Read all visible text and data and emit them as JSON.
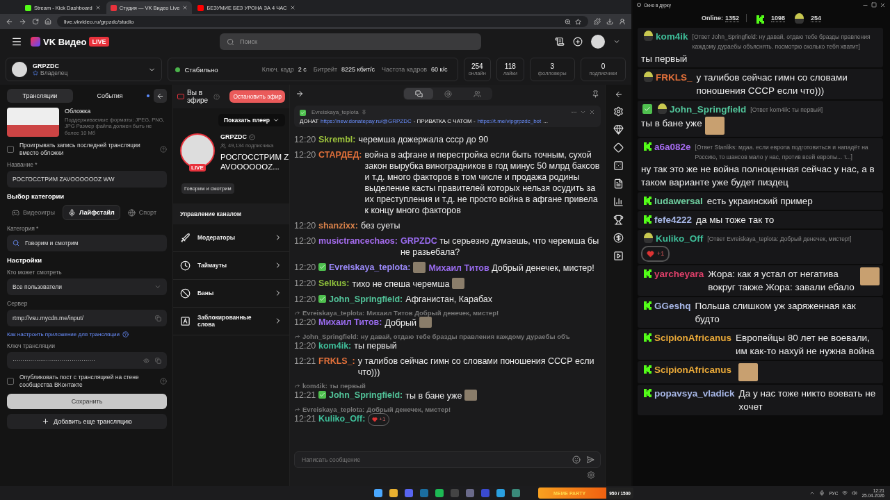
{
  "browser": {
    "tabs": [
      {
        "title": "Stream - Kick Dashboard",
        "selected": false
      },
      {
        "title": "Студия — VK Видео Live",
        "selected": true
      },
      {
        "title": "БЕЗУМИЕ БЕЗ УРОНА ЗА 4 ЧАС",
        "selected": false
      }
    ],
    "url": "live.vkvideo.ru/grpzdc/studio"
  },
  "header": {
    "logo": "VK Видео",
    "logo_badge": "LIVE",
    "search_placeholder": "Поиск"
  },
  "channel_selector": {
    "name": "GRPZDC",
    "role": "Владелец"
  },
  "stream_status": {
    "state": "Стабильно",
    "stats": [
      {
        "label": "Ключ. кадр",
        "value": "2 с"
      },
      {
        "label": "Битрейт",
        "value": "8225 кбит/с"
      },
      {
        "label": "Частота кадров",
        "value": "60 к/с"
      }
    ]
  },
  "counters": [
    {
      "value": "254",
      "label": "онлайн"
    },
    {
      "value": "118",
      "label": "лайки"
    },
    {
      "value": "3",
      "label": "фолловеры"
    },
    {
      "value": "0",
      "label": "подписчики"
    }
  ],
  "settings_panel": {
    "tabs": [
      {
        "label": "Трансляции",
        "selected": true
      },
      {
        "label": "События",
        "selected": false
      }
    ],
    "cover": {
      "title": "Обложка",
      "hint": "Поддерживаемые форматы: JPEG, PNG, JPG Размер файла должен быть не более 10 Мб"
    },
    "replay_checkbox": {
      "label": "Проигрывать запись последней трансляции вместо обложки",
      "checked": false
    },
    "title_field": {
      "label": "Название *",
      "value": "РОСГОССТРИМ ZAVOOOOOOZ WW"
    },
    "category_heading": "Выбор категории",
    "category_types": [
      {
        "label": "Видеоигры",
        "selected": false
      },
      {
        "label": "Лайфстайл",
        "selected": true
      },
      {
        "label": "Спорт",
        "selected": false
      }
    ],
    "category_field": {
      "label": "Категория *",
      "value": "Говорим и смотрим"
    },
    "settings_heading": "Настройки",
    "visibility_field": {
      "label": "Кто может смотреть",
      "value": "Все пользователи"
    },
    "server_field": {
      "label": "Сервер",
      "value": "rtmp://vsu.mycdn.me/input/"
    },
    "help_link": "Как настроить приложение для трансляции",
    "key_field": {
      "label": "Ключ трансляции",
      "value": "··········································"
    },
    "publish_checkbox": {
      "label": "Опубликовать пост с трансляцией на стене сообщества ВКонтакте",
      "checked": false
    },
    "save_button": "Сохранить",
    "add_button": "Добавить еще трансляцию"
  },
  "live_panel": {
    "status": "Вы в эфире",
    "stop_button": "Остановить эфир",
    "player_toggle": "Показать плеер",
    "channel": "GRPZDC",
    "subscribers": "49,134 подписчика",
    "live_badge": "LIVE",
    "stream_title": "РОСГОССТРИМ ZAVOOOOOOZ...",
    "category": "Говорим и смотрим",
    "manage_heading": "Управление каналом",
    "menu": [
      {
        "label": "Модераторы"
      },
      {
        "label": "Таймауты"
      },
      {
        "label": "Баны"
      },
      {
        "label": "Заблокированные слова"
      }
    ]
  },
  "chat": {
    "tabs": [
      {
        "selected": true
      },
      {
        "selected": false
      },
      {
        "selected": false
      }
    ],
    "pinned": {
      "author": "Evreiskaya_teplota",
      "segments": [
        {
          "kind": "text",
          "text": "ДОНАТ"
        },
        {
          "kind": "link",
          "text": "https://new.donatepay.ru/@GRPZDC"
        },
        {
          "kind": "text",
          "text": "- ПРИВАТКА С ЧАТОМ -"
        },
        {
          "kind": "link",
          "text": "https://t.me/vipgrpzdc_bot"
        },
        {
          "kind": "text",
          "text": "..."
        }
      ]
    },
    "messages": [
      {
        "time": "12:20",
        "badge": false,
        "name": "Skrembl:",
        "color": "#9cc23c",
        "parts": [
          {
            "kind": "text",
            "text": "черемша дожержала ссср до 90"
          }
        ]
      },
      {
        "time": "12:20",
        "badge": false,
        "name": "СТАРДЕД:",
        "color": "#e2703a",
        "parts": [
          {
            "kind": "text",
            "text": "война в афгане и перестройка если быть точным, сухой закон вырубка виноградников в год минус 50 млрд баксов и т.д. много факторов в том числе и продажа родины выделение касты правителей которых нельзя осудить за их преступления и т.д. не просто война в афгане привела к концу много факторов"
          }
        ]
      },
      {
        "time": "12:20",
        "badge": false,
        "name": "shanzixx:",
        "color": "#d9824a",
        "parts": [
          {
            "kind": "text",
            "text": "без суеты"
          }
        ]
      },
      {
        "time": "12:20",
        "badge": false,
        "name": "musictrancechaos:",
        "color": "#a66cf0",
        "parts": [
          {
            "kind": "text",
            "text": "**GRPZDC** ты серьезно думаешь, что черемша бы не разьебала?"
          }
        ]
      },
      {
        "time": "12:20",
        "badge": true,
        "name": "Evreiskaya_teplota:",
        "color": "#9e8cff",
        "parts": [
          {
            "kind": "emote"
          },
          {
            "kind": "text",
            "text": "**Михаил Титов** Добрый денечек, мистер!"
          }
        ]
      },
      {
        "time": "12:20",
        "badge": false,
        "name": "Selkus:",
        "color": "#8fc03c",
        "parts": [
          {
            "kind": "text",
            "text": "тихо не спеша черемша"
          },
          {
            "kind": "emote"
          }
        ]
      },
      {
        "time": "12:20",
        "badge": true,
        "name": "John_Springfield:",
        "color": "#52c49a",
        "parts": [
          {
            "kind": "text",
            "text": "Афганистан, Карабах"
          }
        ]
      },
      {
        "time": "12:20",
        "badge": false,
        "name": "Михаил Титов:",
        "color": "#9a6cf0",
        "reply": {
          "name": "Evreiskaya_teplota:",
          "text": "Михаил Титов Добрый денечек, мистер!"
        },
        "parts": [
          {
            "kind": "text",
            "text": "Добрый"
          },
          {
            "kind": "emote"
          }
        ]
      },
      {
        "time": "12:20",
        "badge": false,
        "name": "kom4ik:",
        "color": "#3fbf9a",
        "reply": {
          "name": "John_Springfield:",
          "text": "ну давай, отдаю тебе бразды правления каждому дураебы объ"
        },
        "parts": [
          {
            "kind": "text",
            "text": "ты первый"
          }
        ]
      },
      {
        "time": "12:21",
        "badge": false,
        "name": "FRKLS_:",
        "color": "#e2703a",
        "parts": [
          {
            "kind": "text",
            "text": "у талибов сейчас гимн со словами поношения СССР если что)))"
          }
        ]
      },
      {
        "time": "12:21",
        "badge": true,
        "name": "John_Springfield:",
        "color": "#52c49a",
        "reply": {
          "name": "kom4ik:",
          "text": "ты первый"
        },
        "parts": [
          {
            "kind": "text",
            "text": "ты в бане уже"
          },
          {
            "kind": "emote"
          }
        ]
      },
      {
        "time": "12:21",
        "badge": false,
        "name": "Kuliko_Off:",
        "color": "#3fbf9a",
        "reply": {
          "name": "Evreiskaya_teplota:",
          "text": "Добрый денечек, мистер!"
        },
        "parts": [
          {
            "kind": "reaction",
            "text": "+1"
          }
        ]
      }
    ],
    "input_placeholder": "Написать сообщение"
  },
  "overlay_window": {
    "title": "Окно в дурку",
    "online_label": "Online:",
    "online_value": "1352",
    "kick_count": "1098",
    "other_count": "254",
    "messages": [
      {
        "kind": "avatar",
        "name": "kom4ik",
        "color": "#3fbf9a",
        "reply": "[Ответ John_Springfield: ну давай, отдаю тебе бразды правления каждому дураебы объяснять. посмотрю сколько тебя хватит]",
        "text": "ты первый"
      },
      {
        "kind": "avatar",
        "name": "FRKLS_",
        "color": "#e2703a",
        "text": "у талибов сейчас гимн со словами поношения СССР если что)))"
      },
      {
        "kind": "badge",
        "name": "John_Springfield",
        "color": "#52c49a",
        "reply": "[Ответ kom4ik: ты первый]",
        "text": "ты в бане уже",
        "emote": true
      },
      {
        "kind": "kick",
        "name": "а6а082е",
        "color": "#a66cf0",
        "reply": "[Ответ Stanliks: мдаа. если европа подготовиться и нападёт на Россию, то шансов мало у нас, против всей европы... т...]",
        "text": "ну так это же не война полноценная сейчас у нас, а в таком варианте уже будет пиздец"
      },
      {
        "kind": "kick",
        "name": "ludawersal",
        "color": "#6fd0a0",
        "text": "есть украинский пример"
      },
      {
        "kind": "kick",
        "name": "fefe4222",
        "color": "#a8b8e8",
        "text": "да мы тоже так то"
      },
      {
        "kind": "avatar",
        "name": "Kuliko_Off",
        "color": "#3fbf9a",
        "reply": "[Ответ Evreiskaya_teplota: Добрый денечек, мистер!]",
        "reaction": "+1"
      },
      {
        "kind": "kick",
        "name": "yarcheyara",
        "color": "#e0406a",
        "text": "Жора: как я устал от негатива вокруг также Жора: завали ебало",
        "emote": true
      },
      {
        "kind": "kick",
        "name": "GGeshq",
        "color": "#a8b8e8",
        "text": "Польша слишком уж заряженная как будто"
      },
      {
        "kind": "kick",
        "name": "ScipionAfricanus",
        "color": "#e8a838",
        "text": "Европейцы 80 лет не воевали, им как-то нахуй не нужна война"
      },
      {
        "kind": "kick",
        "name": "ScipionAfricanus",
        "color": "#e8a838",
        "emote": true
      },
      {
        "kind": "kick",
        "name": "popavsya_vladick",
        "color": "#a8b8e8",
        "text": "Да у нас тоже никто воевать не хочет"
      }
    ]
  },
  "taskbar": {
    "widget_title": "MEME PARTY",
    "widget_value": "950 / 1500",
    "language": "РУС",
    "time": "12:21",
    "date": "25.04.2026"
  }
}
